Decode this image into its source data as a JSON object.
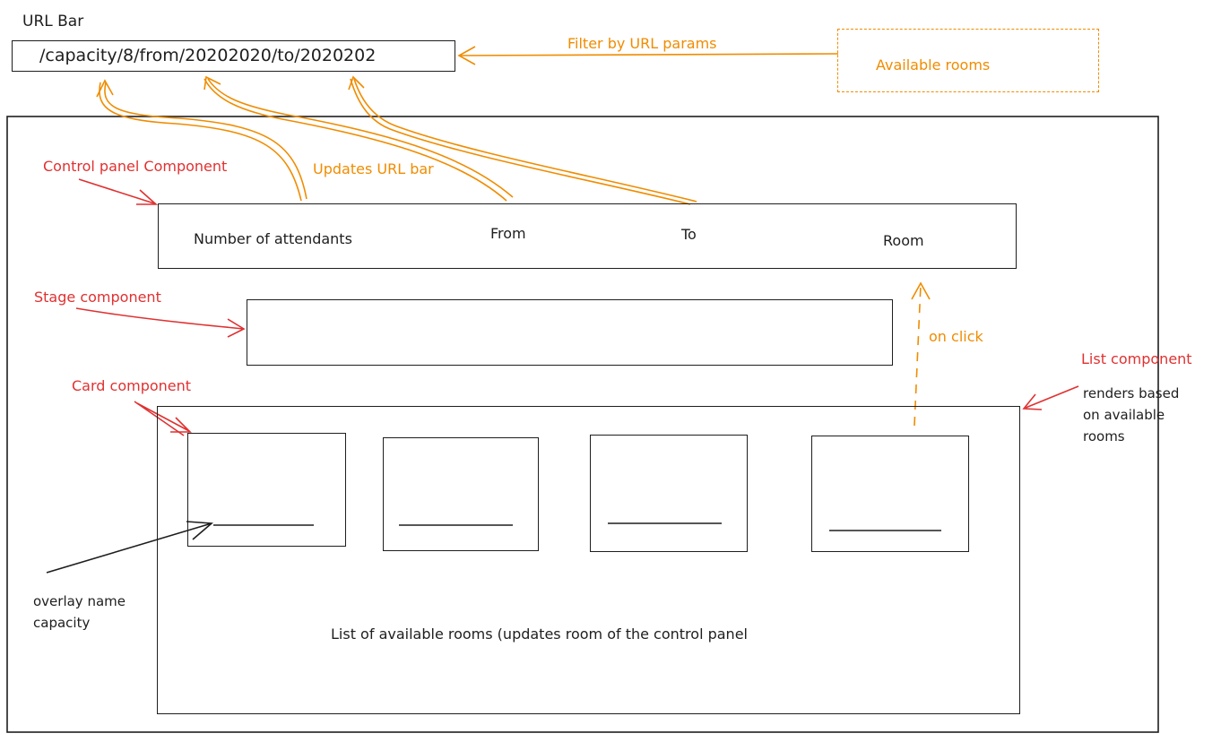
{
  "url_bar": {
    "label": "URL Bar",
    "value": "/capacity/8/from/20202020/to/2020202"
  },
  "available_rooms": {
    "label": "Available rooms"
  },
  "annotations": {
    "filter_by_url_params": "Filter by URL params",
    "updates_url_bar": "Updates URL bar",
    "control_panel_component": "Control panel Component",
    "stage_component": "Stage component",
    "card_component": "Card component",
    "list_component": "List component",
    "list_component_note": [
      "renders based",
      "on available",
      "rooms"
    ],
    "on_click": "on click",
    "overlay_note": [
      "overlay name",
      "capacity"
    ]
  },
  "control_panel": {
    "fields": [
      "Number of attendants",
      "From",
      "To",
      "Room"
    ]
  },
  "list": {
    "caption": "List of available rooms (updates room of the control panel",
    "card_count": 4
  },
  "colors": {
    "ink": "#1e1e1e",
    "orange": "#f08c00",
    "red": "#e03131"
  }
}
